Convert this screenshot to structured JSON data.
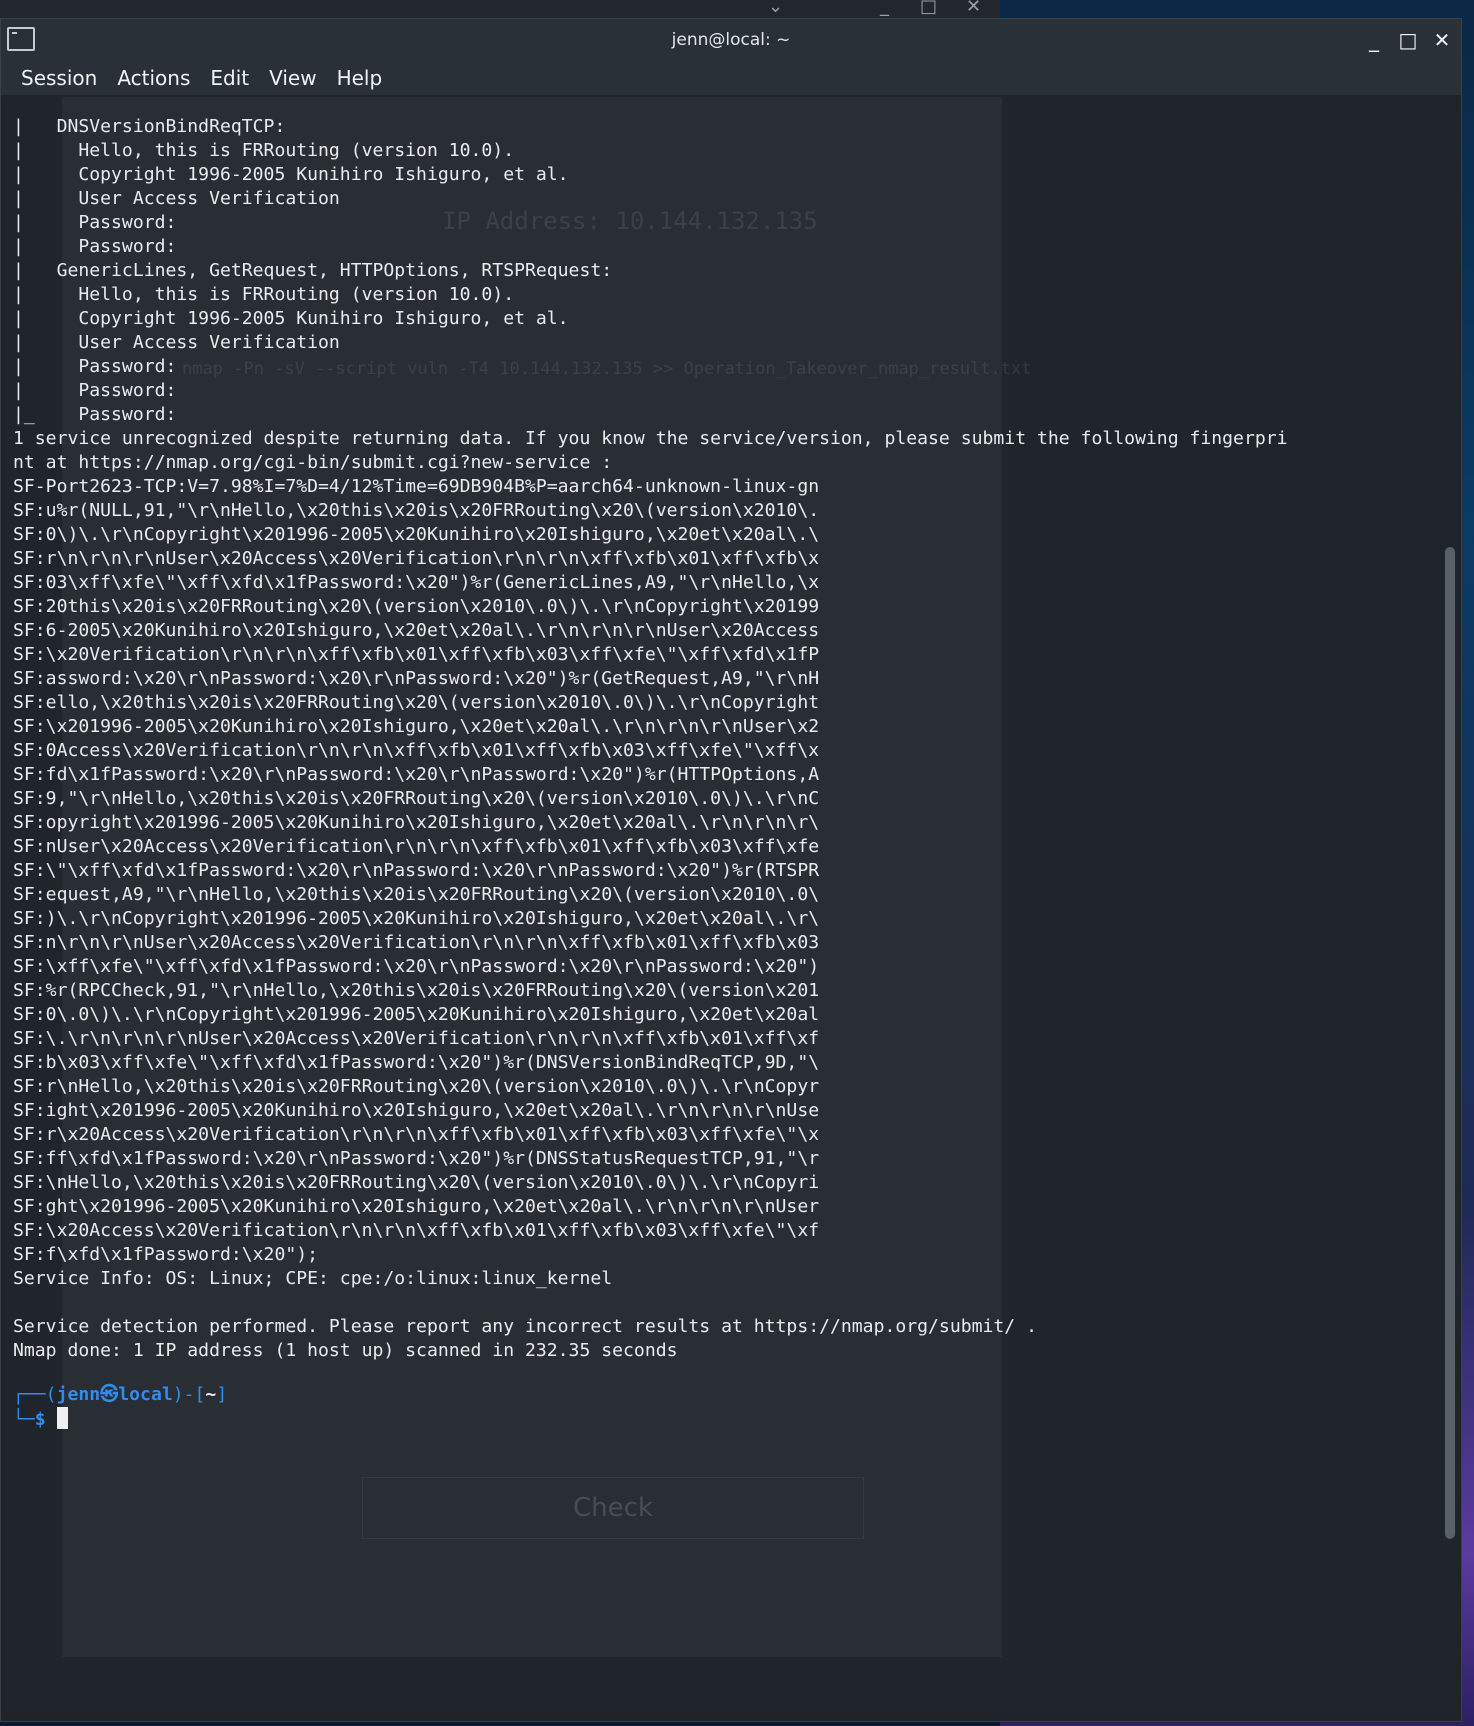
{
  "window": {
    "title": "jenn@local: ~",
    "controls": {
      "minimize": "_",
      "maximize": "□",
      "close": "✕"
    }
  },
  "menu": [
    "Session",
    "Actions",
    "Edit",
    "View",
    "Help"
  ],
  "terminal": {
    "lines": [
      "|   DNSVersionBindReqTCP:",
      "|     Hello, this is FRRouting (version 10.0).",
      "|     Copyright 1996-2005 Kunihiro Ishiguro, et al.",
      "|     User Access Verification",
      "|     Password:",
      "|     Password:",
      "|   GenericLines, GetRequest, HTTPOptions, RTSPRequest:",
      "|     Hello, this is FRRouting (version 10.0).",
      "|     Copyright 1996-2005 Kunihiro Ishiguro, et al.",
      "|     User Access Verification",
      "|     Password:",
      "|     Password:",
      "|_    Password:",
      "1 service unrecognized despite returning data. If you know the service/version, please submit the following fingerpri",
      "nt at https://nmap.org/cgi-bin/submit.cgi?new-service :",
      "SF-Port2623-TCP:V=7.98%I=7%D=4/12%Time=69DB904B%P=aarch64-unknown-linux-gn",
      "SF:u%r(NULL,91,\"\\r\\nHello,\\x20this\\x20is\\x20FRRouting\\x20\\(version\\x2010\\.",
      "SF:0\\)\\.\\r\\nCopyright\\x201996-2005\\x20Kunihiro\\x20Ishiguro,\\x20et\\x20al\\.\\",
      "SF:r\\n\\r\\n\\r\\nUser\\x20Access\\x20Verification\\r\\n\\r\\n\\xff\\xfb\\x01\\xff\\xfb\\x",
      "SF:03\\xff\\xfe\\\"\\xff\\xfd\\x1fPassword:\\x20\")%r(GenericLines,A9,\"\\r\\nHello,\\x",
      "SF:20this\\x20is\\x20FRRouting\\x20\\(version\\x2010\\.0\\)\\.\\r\\nCopyright\\x20199",
      "SF:6-2005\\x20Kunihiro\\x20Ishiguro,\\x20et\\x20al\\.\\r\\n\\r\\n\\r\\nUser\\x20Access",
      "SF:\\x20Verification\\r\\n\\r\\n\\xff\\xfb\\x01\\xff\\xfb\\x03\\xff\\xfe\\\"\\xff\\xfd\\x1fP",
      "SF:assword:\\x20\\r\\nPassword:\\x20\\r\\nPassword:\\x20\")%r(GetRequest,A9,\"\\r\\nH",
      "SF:ello,\\x20this\\x20is\\x20FRRouting\\x20\\(version\\x2010\\.0\\)\\.\\r\\nCopyright",
      "SF:\\x201996-2005\\x20Kunihiro\\x20Ishiguro,\\x20et\\x20al\\.\\r\\n\\r\\n\\r\\nUser\\x2",
      "SF:0Access\\x20Verification\\r\\n\\r\\n\\xff\\xfb\\x01\\xff\\xfb\\x03\\xff\\xfe\\\"\\xff\\x",
      "SF:fd\\x1fPassword:\\x20\\r\\nPassword:\\x20\\r\\nPassword:\\x20\")%r(HTTPOptions,A",
      "SF:9,\"\\r\\nHello,\\x20this\\x20is\\x20FRRouting\\x20\\(version\\x2010\\.0\\)\\.\\r\\nC",
      "SF:opyright\\x201996-2005\\x20Kunihiro\\x20Ishiguro,\\x20et\\x20al\\.\\r\\n\\r\\n\\r\\",
      "SF:nUser\\x20Access\\x20Verification\\r\\n\\r\\n\\xff\\xfb\\x01\\xff\\xfb\\x03\\xff\\xfe",
      "SF:\\\"\\xff\\xfd\\x1fPassword:\\x20\\r\\nPassword:\\x20\\r\\nPassword:\\x20\")%r(RTSPR",
      "SF:equest,A9,\"\\r\\nHello,\\x20this\\x20is\\x20FRRouting\\x20\\(version\\x2010\\.0\\",
      "SF:)\\.\\r\\nCopyright\\x201996-2005\\x20Kunihiro\\x20Ishiguro,\\x20et\\x20al\\.\\r\\",
      "SF:n\\r\\n\\r\\nUser\\x20Access\\x20Verification\\r\\n\\r\\n\\xff\\xfb\\x01\\xff\\xfb\\x03",
      "SF:\\xff\\xfe\\\"\\xff\\xfd\\x1fPassword:\\x20\\r\\nPassword:\\x20\\r\\nPassword:\\x20\")",
      "SF:%r(RPCCheck,91,\"\\r\\nHello,\\x20this\\x20is\\x20FRRouting\\x20\\(version\\x201",
      "SF:0\\.0\\)\\.\\r\\nCopyright\\x201996-2005\\x20Kunihiro\\x20Ishiguro,\\x20et\\x20al",
      "SF:\\.\\r\\n\\r\\n\\r\\nUser\\x20Access\\x20Verification\\r\\n\\r\\n\\xff\\xfb\\x01\\xff\\xf",
      "SF:b\\x03\\xff\\xfe\\\"\\xff\\xfd\\x1fPassword:\\x20\")%r(DNSVersionBindReqTCP,9D,\"\\",
      "SF:r\\nHello,\\x20this\\x20is\\x20FRRouting\\x20\\(version\\x2010\\.0\\)\\.\\r\\nCopyr",
      "SF:ight\\x201996-2005\\x20Kunihiro\\x20Ishiguro,\\x20et\\x20al\\.\\r\\n\\r\\n\\r\\nUse",
      "SF:r\\x20Access\\x20Verification\\r\\n\\r\\n\\xff\\xfb\\x01\\xff\\xfb\\x03\\xff\\xfe\\\"\\x",
      "SF:ff\\xfd\\x1fPassword:\\x20\\r\\nPassword:\\x20\")%r(DNSStatusRequestTCP,91,\"\\r",
      "SF:\\nHello,\\x20this\\x20is\\x20FRRouting\\x20\\(version\\x2010\\.0\\)\\.\\r\\nCopyri",
      "SF:ght\\x201996-2005\\x20Kunihiro\\x20Ishiguro,\\x20et\\x20al\\.\\r\\n\\r\\n\\r\\nUser",
      "SF:\\x20Access\\x20Verification\\r\\n\\r\\n\\xff\\xfb\\x01\\xff\\xfb\\x03\\xff\\xfe\\\"\\xf",
      "SF:f\\xfd\\x1fPassword:\\x20\");",
      "Service Info: OS: Linux; CPE: cpe:/o:linux:linux_kernel",
      "",
      "Service detection performed. Please report any incorrect results at https://nmap.org/submit/ .",
      "Nmap done: 1 IP address (1 host up) scanned in 232.35 seconds"
    ],
    "prompt": {
      "user": "jenn",
      "at": "㉿",
      "host": "local",
      "dir": "~",
      "symbol": "$"
    }
  },
  "background_ghost": {
    "ip_label": "IP Address: 10.144.132.135",
    "check_button": "Check",
    "command": "nmap -Pn -sV --script vuln -T4 10.144.132.135 >> Operation_Takeover_nmap_result.txt"
  }
}
